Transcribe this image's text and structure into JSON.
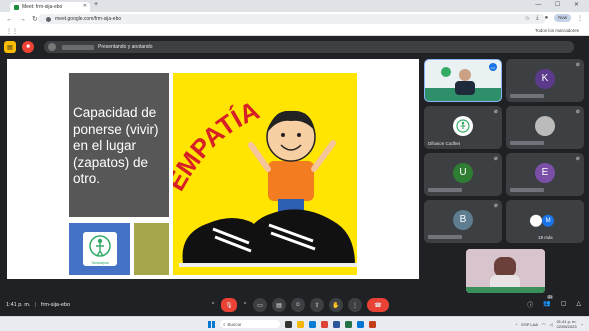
{
  "browser": {
    "tab_title": "Meet: frm-sija-ebo",
    "url": "meet.google.com/frm-sija-ebo",
    "profile_label": "Nvw",
    "all_bookmarks": "Todos los marcadores"
  },
  "meet": {
    "presenter_status": "Presentando y anotando",
    "time": "1:41 p. m.",
    "separator": "|",
    "meeting_code": "frm-sija-ebo",
    "people_badge": "21"
  },
  "slide": {
    "lines": [
      "Capacidad de",
      "ponerse (vivir)",
      "en el lugar",
      "(zapatos) de",
      "otro."
    ],
    "art_word": "EMPATÍA",
    "logo_caption": "Tamaulipas"
  },
  "tiles": [
    {
      "type": "video",
      "initial": ""
    },
    {
      "type": "avatar",
      "initial": "K",
      "color": "#5b3a8c"
    },
    {
      "type": "logo",
      "label": "Difusion Codhet"
    },
    {
      "type": "photo",
      "initial": ""
    },
    {
      "type": "avatar",
      "initial": "U",
      "color": "#2f7d32"
    },
    {
      "type": "avatar",
      "initial": "E",
      "color": "#7b4fa8"
    },
    {
      "type": "avatar",
      "initial": "B",
      "color": "#5e7d90"
    },
    {
      "type": "more",
      "initial": "M",
      "label": "19 más"
    }
  ],
  "taskbar": {
    "search_placeholder": "Buscar",
    "tray_lang": "ESP LAA",
    "clock_time": "01:41 p. m.",
    "clock_date": "22/05/2023"
  },
  "colors": {
    "meet_bg": "#202124",
    "hangup": "#ea4335",
    "slide_gray": "#575757",
    "slide_blue": "#4472c4",
    "slide_olive": "#a6a64a",
    "art_yellow": "#ffe500"
  }
}
